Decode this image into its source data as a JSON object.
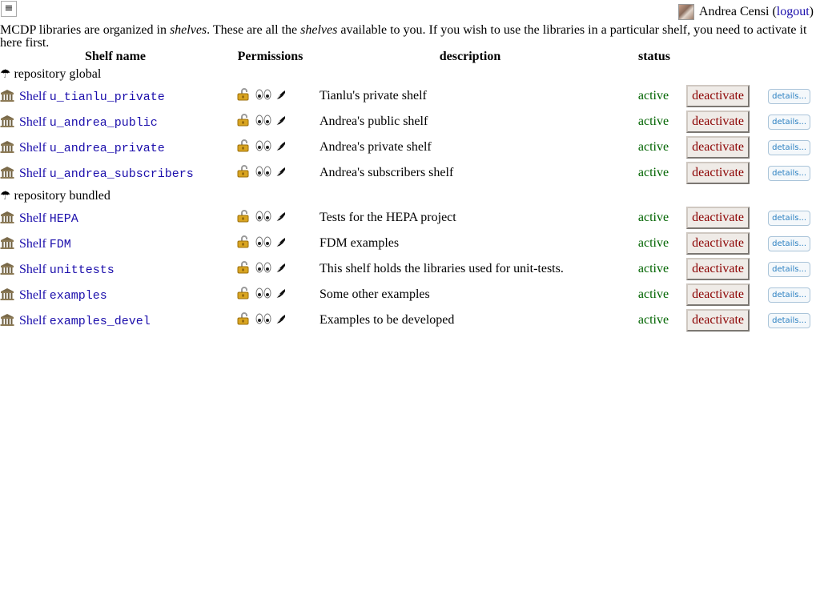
{
  "menu": {
    "glyph": "≡"
  },
  "user": {
    "name": "Andrea Censi",
    "paren_open": "(",
    "logout_label": "logout",
    "paren_close": ")"
  },
  "intro": {
    "part1": "MCDP libraries are organized in ",
    "em1": "shelves",
    "part2": ". These are all the ",
    "em2": "shelves",
    "part3": " available to you. If you wish to use the libraries in a particular shelf, you need to activate it here first."
  },
  "table": {
    "headers": [
      "Shelf name",
      "Permissions",
      "description",
      "status"
    ],
    "repositories": [
      {
        "label": "repository global",
        "shelves": [
          {
            "prefix": "Shelf",
            "name": "u_tianlu_private",
            "description": "Tianlu's private shelf",
            "status": "active",
            "action": "deactivate",
            "details": "details..."
          },
          {
            "prefix": "Shelf",
            "name": "u_andrea_public",
            "description": "Andrea's public shelf",
            "status": "active",
            "action": "deactivate",
            "details": "details..."
          },
          {
            "prefix": "Shelf",
            "name": "u_andrea_private",
            "description": "Andrea's private shelf",
            "status": "active",
            "action": "deactivate",
            "details": "details..."
          },
          {
            "prefix": "Shelf",
            "name": "u_andrea_subscribers",
            "description": "Andrea's subscribers shelf",
            "status": "active",
            "action": "deactivate",
            "details": "details..."
          }
        ]
      },
      {
        "label": "repository bundled",
        "shelves": [
          {
            "prefix": "Shelf",
            "name": "HEPA",
            "description": "Tests for the HEPA project",
            "status": "active",
            "action": "deactivate",
            "details": "details..."
          },
          {
            "prefix": "Shelf",
            "name": "FDM",
            "description": "FDM examples",
            "status": "active",
            "action": "deactivate",
            "details": "details..."
          },
          {
            "prefix": "Shelf",
            "name": "unittests",
            "description": "This shelf holds the libraries used for unit-tests.",
            "status": "active",
            "action": "deactivate",
            "details": "details..."
          },
          {
            "prefix": "Shelf",
            "name": "examples",
            "description": "Some other examples",
            "status": "active",
            "action": "deactivate",
            "details": "details..."
          },
          {
            "prefix": "Shelf",
            "name": "examples_devel",
            "description": "Examples to be developed",
            "status": "active",
            "action": "deactivate",
            "details": "details..."
          }
        ]
      }
    ]
  },
  "icons": {
    "repository": "umbrella-icon",
    "shelf": "library-building-icon",
    "permissions": [
      "lock-icon",
      "eyes-icon",
      "pen-nib-icon"
    ]
  },
  "colors": {
    "link": "#1a0dab",
    "active": "#006400",
    "deactivate_text": "#8b0000",
    "details_text": "#2a7fc1"
  }
}
